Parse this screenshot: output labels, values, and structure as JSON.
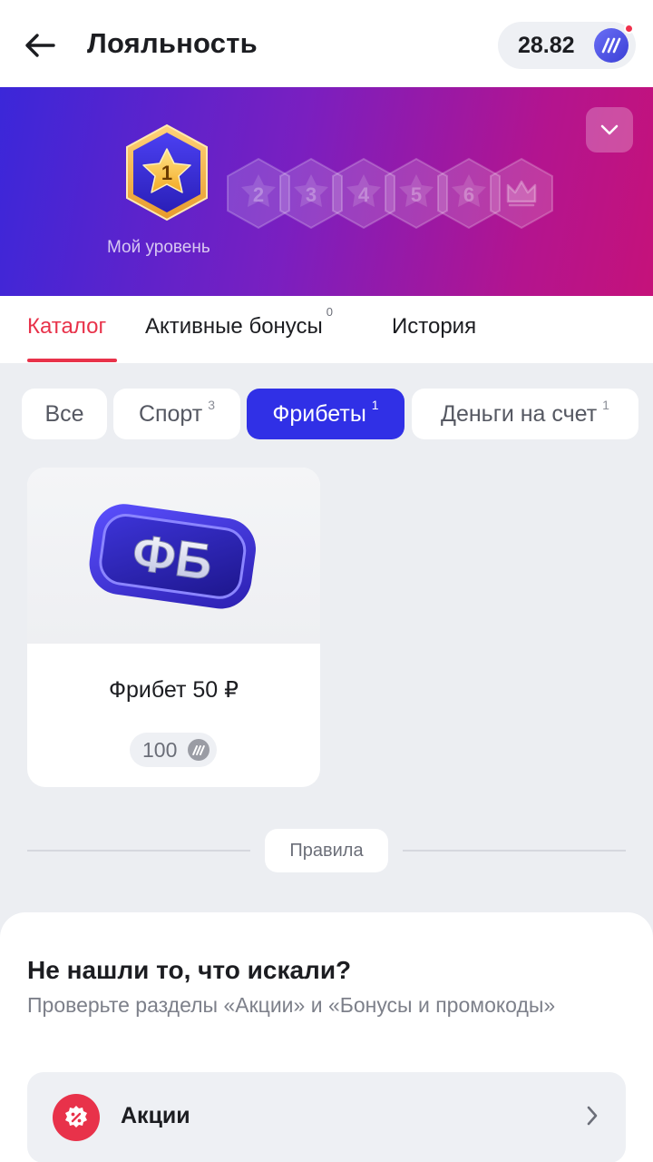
{
  "header": {
    "title": "Лояльность",
    "balance": "28.82",
    "has_notification": true
  },
  "banner": {
    "current_level": "1",
    "my_level_label": "Мой уровень",
    "locked_levels": [
      "2",
      "3",
      "4",
      "5",
      "6"
    ],
    "top_level_icon": "crown-icon"
  },
  "tabs": [
    {
      "label": "Каталог",
      "count": "",
      "active": true
    },
    {
      "label": "Активные бонусы",
      "count": "0",
      "active": false
    },
    {
      "label": "История",
      "count": "",
      "active": false
    }
  ],
  "filters": [
    {
      "label": "Все",
      "count": "",
      "active": false
    },
    {
      "label": "Спорт",
      "count": "3",
      "active": false
    },
    {
      "label": "Фрибеты",
      "count": "1",
      "active": true
    },
    {
      "label": "Деньги на счет",
      "count": "1",
      "active": false
    }
  ],
  "catalog": [
    {
      "badge_text": "ФБ",
      "title": "Фрибет 50 ₽",
      "price": "100"
    }
  ],
  "rules_label": "Правила",
  "bottom_sheet": {
    "title": "Не нашли то, что искали?",
    "subtitle": "Проверьте разделы «Акции» и «Бонусы и промокоды»",
    "links": [
      {
        "label": "Акции",
        "icon": "promo-percent-icon"
      }
    ]
  },
  "colors": {
    "accent_red": "#e8324a",
    "accent_blue": "#3030e6"
  }
}
